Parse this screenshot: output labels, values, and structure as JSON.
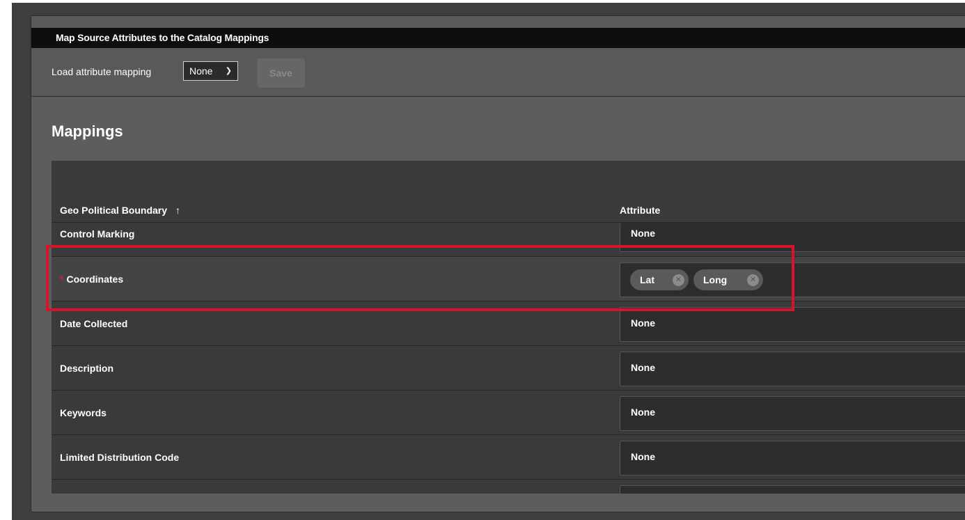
{
  "panel": {
    "title": "Map Source Attributes to the Catalog Mappings"
  },
  "toolbar": {
    "load_label": "Load attribute mapping",
    "select_value": "None",
    "save_label": "Save"
  },
  "mappings": {
    "title": "Mappings",
    "columns": {
      "geo": "Geo Political Boundary",
      "attribute": "Attribute"
    },
    "rows": [
      {
        "label": "Control Marking",
        "value": "None"
      },
      {
        "label": "Coordinates",
        "required": "*",
        "chips": [
          "Lat",
          "Long"
        ]
      },
      {
        "label": "Date Collected",
        "value": "None"
      },
      {
        "label": "Description",
        "value": "None"
      },
      {
        "label": "Keywords",
        "value": "None"
      },
      {
        "label": "Limited Distribution Code",
        "value": "None"
      }
    ]
  },
  "colors": {
    "highlight": "#d8142a",
    "required": "#d0202e"
  },
  "icons": {
    "sort": "arrow-up-icon",
    "select": "chevron-down-icon",
    "chip_remove": "close-circle-icon"
  }
}
